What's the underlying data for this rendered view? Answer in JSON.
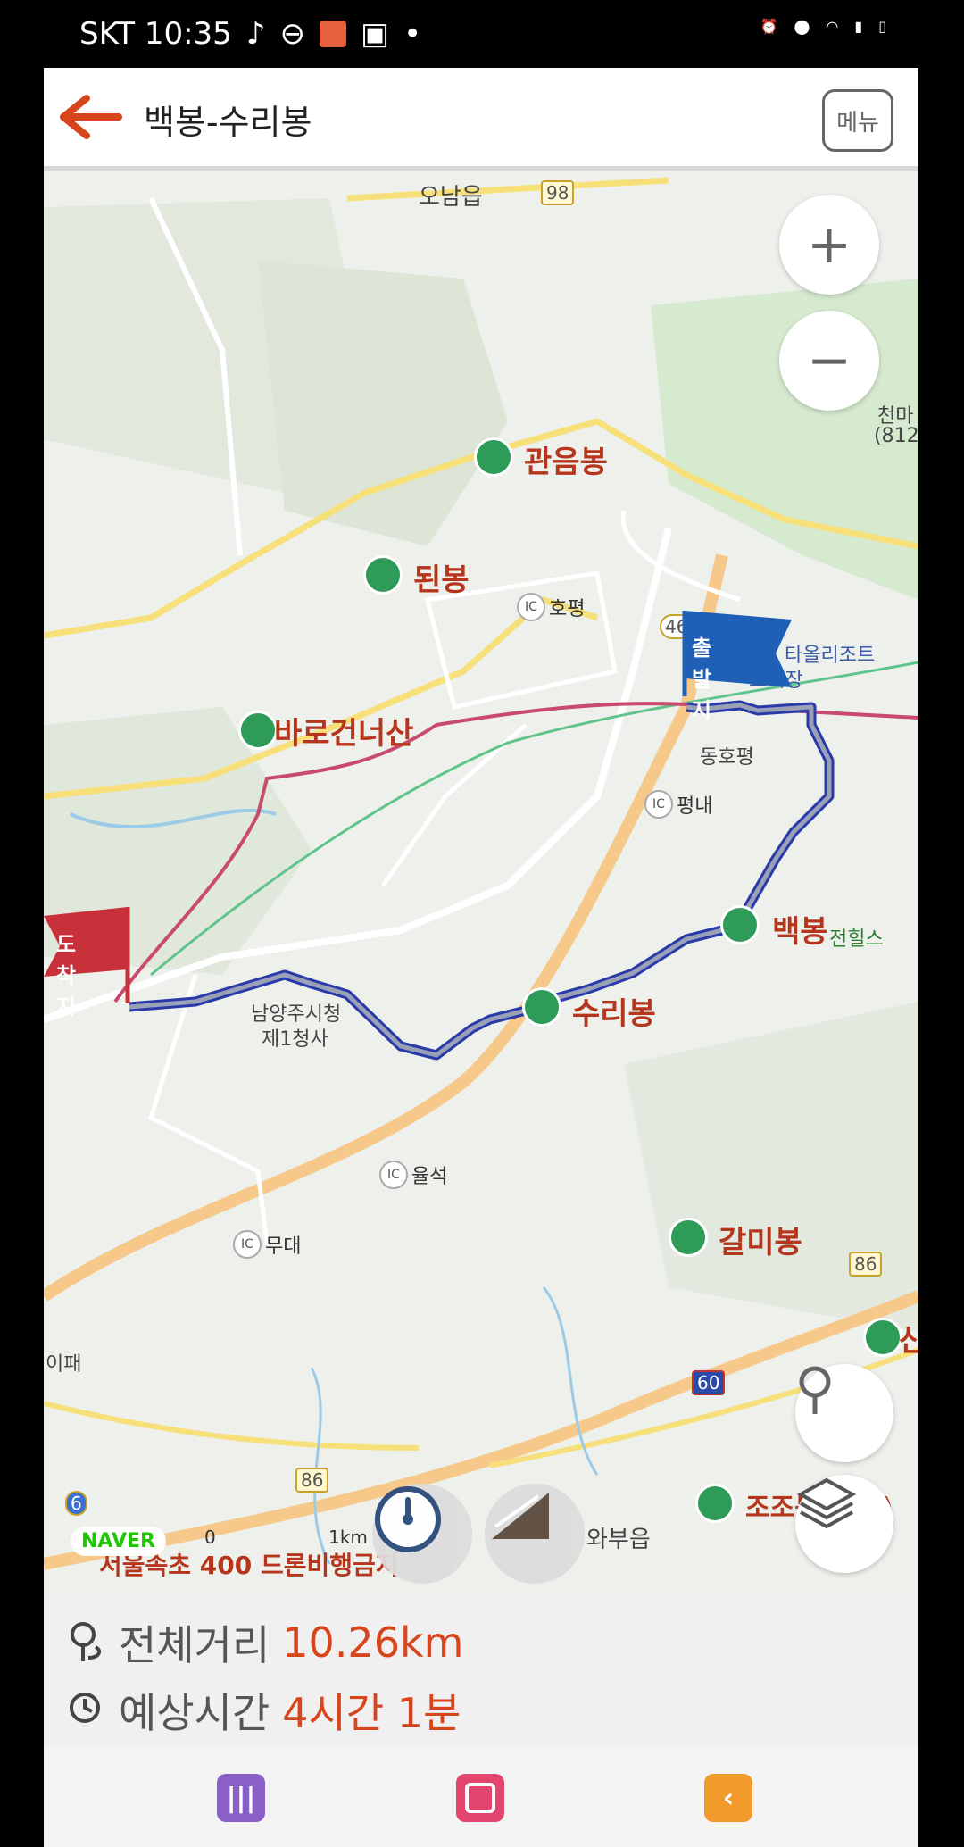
{
  "status_bar": {
    "carrier_time": "SKT 10:35"
  },
  "header": {
    "title": "백봉-수리봉",
    "menu_label": "메뉴"
  },
  "map": {
    "places": {
      "onam": "오남읍",
      "road98": "98",
      "hopyeong": "호평",
      "road46": "46",
      "dongho": "동호평",
      "pyeongnae": "평내",
      "yulseok": "율석",
      "mudae": "무대",
      "road86a": "86",
      "road86b": "86",
      "road60": "60",
      "road6": "6",
      "wabu": "와부읍",
      "ipae": "이패",
      "namyangju": "남양주시청",
      "namyangju2": "제1청사",
      "ski": "스키장",
      "ski_resort": "타올리조트",
      "jeonhills": "전힐스",
      "cheonma": "천마",
      "cheonma2": "(812",
      "seoul_exp": "서울속초 400 드론비행금지"
    },
    "peaks": {
      "gwaneum": "관음봉",
      "doen": "된봉",
      "baro": "바로건너산",
      "baekbong": "백봉",
      "suri": "수리봉",
      "galmi": "갈미봉",
      "jojo": "조조봉(미봉)",
      "san": "산"
    },
    "flags": {
      "start": "출발지",
      "end": "도착지"
    },
    "zoom_in": "+",
    "zoom_out": "−",
    "naver": "NAVER",
    "scale_zero": "0",
    "scale_km": "1km"
  },
  "info": {
    "distance_label": "전체거리",
    "distance_value": "10.26km",
    "time_label": "예상시간",
    "time_value": "4시간 1분"
  },
  "colors": {
    "accent": "#d6451b",
    "route": "#2a3aa8",
    "start_flag": "#1f5fb5",
    "end_flag": "#c8303a"
  }
}
